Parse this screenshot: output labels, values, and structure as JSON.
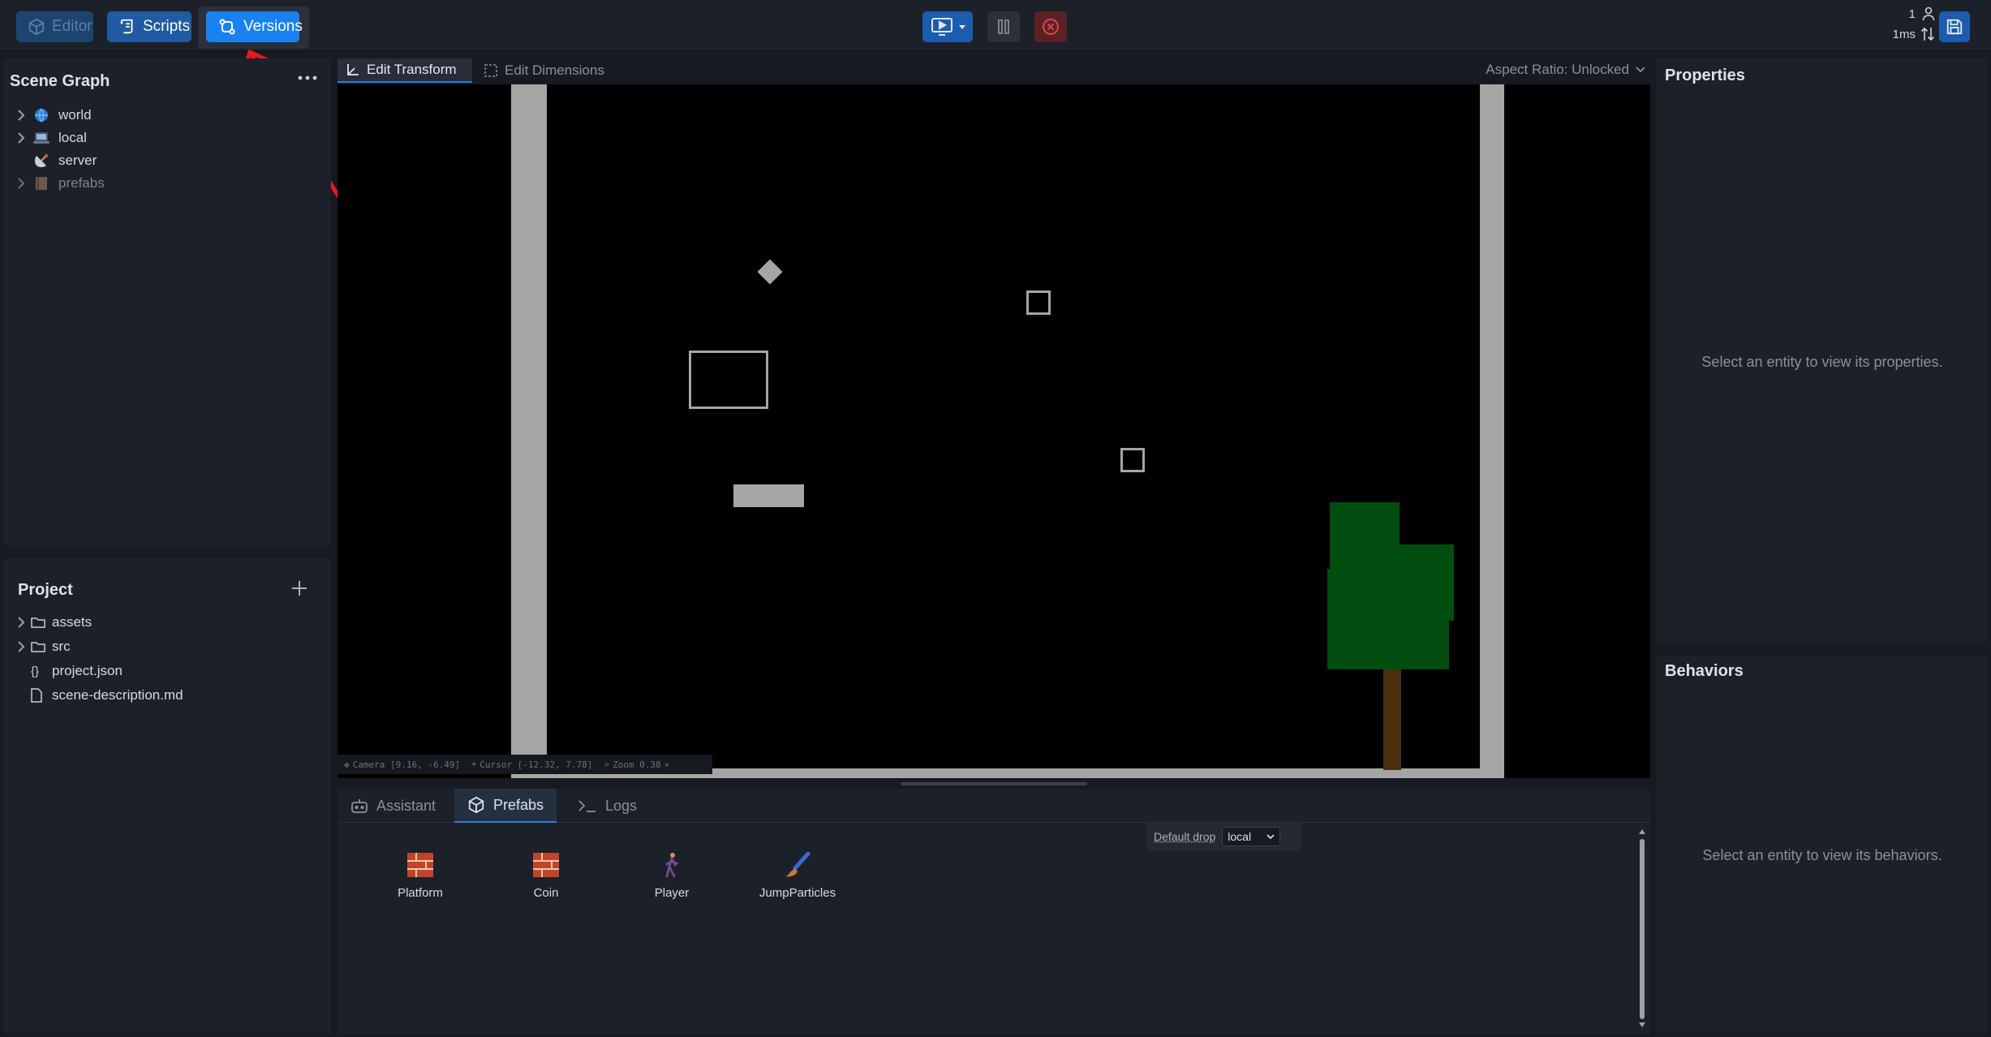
{
  "topbar": {
    "editor_label": "Editor",
    "scripts_label": "Scripts",
    "versions_label": "Versions",
    "users_count": "1",
    "latency": "1ms",
    "accent": "#1a82f0"
  },
  "scene_graph": {
    "title": "Scene Graph",
    "items": [
      {
        "label": "world",
        "icon": "globe-icon",
        "expandable": true
      },
      {
        "label": "local",
        "icon": "laptop-icon",
        "expandable": true
      },
      {
        "label": "server",
        "icon": "satellite-icon",
        "expandable": false
      },
      {
        "label": "prefabs",
        "icon": "book-icon",
        "expandable": true
      }
    ]
  },
  "project": {
    "title": "Project",
    "items": [
      {
        "label": "assets",
        "icon": "folder-icon",
        "expandable": true
      },
      {
        "label": "src",
        "icon": "folder-icon",
        "expandable": true
      },
      {
        "label": "project.json",
        "icon": "braces-icon",
        "expandable": false
      },
      {
        "label": "scene-description.md",
        "icon": "file-icon",
        "expandable": false
      }
    ]
  },
  "viewport": {
    "tab_transform": "Edit Transform",
    "tab_dimensions": "Edit Dimensions",
    "aspect_ratio": "Aspect Ratio: Unlocked",
    "camera": "Camera [9.16, -6.49]",
    "cursor": "Cursor [-12.32, 7.78]",
    "zoom": "Zoom 0.38"
  },
  "bottom": {
    "tabs": [
      "Assistant",
      "Prefabs",
      "Logs"
    ],
    "default_drop_label": "Default drop",
    "default_drop_value": "local",
    "prefabs": [
      {
        "label": "Platform",
        "icon": "brick-icon"
      },
      {
        "label": "Coin",
        "icon": "brick-icon"
      },
      {
        "label": "Player",
        "icon": "person-walking-icon"
      },
      {
        "label": "JumpParticles",
        "icon": "paintbrush-icon"
      }
    ]
  },
  "properties": {
    "title": "Properties",
    "empty": "Select an entity to view its properties."
  },
  "behaviors": {
    "title": "Behaviors",
    "empty": "Select an entity to view its behaviors."
  }
}
